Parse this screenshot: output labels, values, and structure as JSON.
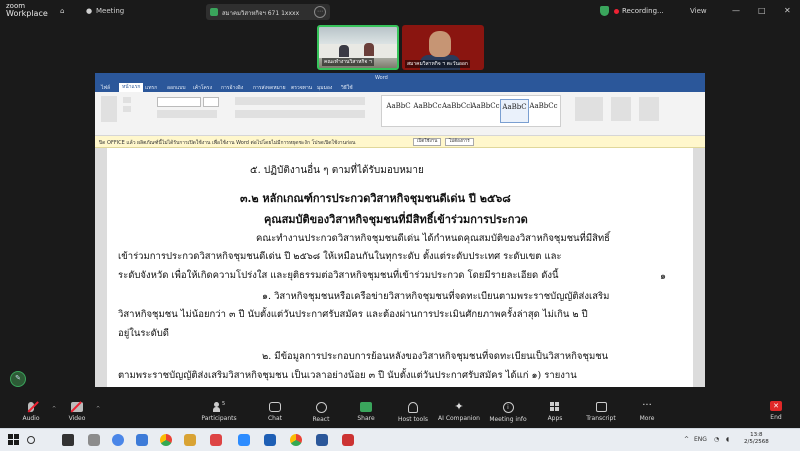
{
  "zoom": {
    "logo": {
      "line1": "zoom",
      "line2": "Workplace"
    },
    "topbar": {
      "home_label": "Home",
      "meeting_label": "Meeting",
      "meeting_pill": "สมาคมวิสาหกิจฯ 671 1xxxx",
      "recording": "Recording...",
      "view": "View",
      "minimize": "—",
      "maximize": "□",
      "close": "✕"
    },
    "participants": [
      {
        "name": "คณะทำงานวิสาหกิจ ฯ"
      },
      {
        "name": "สมาคมวิสาหกิจ ฯ ตะวันออก"
      }
    ],
    "toolbar": {
      "audio": "Audio",
      "video": "Video",
      "participants": "Participants",
      "participants_count": "5",
      "chat": "Chat",
      "react": "React",
      "share": "Share",
      "host_tools": "Host tools",
      "ai_companion": "AI Companion",
      "meeting_info": "Meeting info",
      "apps": "Apps",
      "transcript": "Transcript",
      "more": "More",
      "end": "End"
    }
  },
  "word": {
    "title": "Word",
    "tabs": [
      "ไฟล์",
      "หน้าแรก",
      "แทรก",
      "ออกแบบ",
      "เค้าโครง",
      "การอ้างอิง",
      "การส่งจดหมาย",
      "ตรวจทาน",
      "มุมมอง",
      "วิธีใช้"
    ],
    "active_tab": "หน้าแรก",
    "font_name": "TH SarabunPSK",
    "font_size": "16",
    "styles": [
      "AaBbC",
      "AaBbCc",
      "AaBbCcl",
      "AaBbCc",
      "AaBbC",
      "AaBbCc"
    ],
    "infobar": {
      "message": "ปิด OFFICE แล้ว ผลิตภัณฑ์นี้ไม่ได้รับการเปิดใช้งาน เพื่อใช้งาน Word ต่อไปโดยไม่มีการหยุดชะงัก โปรดเปิดใช้งานก่อน",
      "button1": "เปิดใช้งาน",
      "button2": "ไม่ต้องการ"
    }
  },
  "document": {
    "line_item5": "๕. ปฏิบัติงานอื่น ๆ ตามที่ได้รับมอบหมาย",
    "heading": "๓.๒ หลักเกณฑ์การประกวดวิสาหกิจชุมชนดีเด่น ปี ๒๕๖๘",
    "subheading": "คุณสมบัติของวิสาหกิจชุมชนที่มีสิทธิ์เข้าร่วมการประกวด",
    "lines": [
      "คณะทำงานประกวดวิสาหกิจชุมชนดีเด่น ได้กำหนดคุณสมบัติของวิสาหกิจชุมชนที่มีสิทธิ์",
      "เข้าร่วมการประกวดวิสาหกิจชุมชนดีเด่น ปี ๒๕๖๘ ให้เหมือนกันในทุกระดับ ตั้งแต่ระดับประเทศ ระดับเขต และ",
      "ระดับจังหวัด เพื่อให้เกิดความโปร่งใส และยุติธรรมต่อวิสาหกิจชุมชนที่เข้าร่วมประกวด โดยมีรายละเอียด ดังนี้",
      "๑. วิสาหกิจชุมชนหรือเครือข่ายวิสาหกิจชุมชนที่จดทะเบียนตามพระราชบัญญัติส่งเสริม",
      "วิสาหกิจชุมชน ไม่น้อยกว่า ๓ ปี นับตั้งแต่วันประกาศรับสมัคร และต้องผ่านการประเมินศักยภาพครั้งล่าสุด ไม่เกิน ๒ ปี",
      "อยู่ในระดับดี",
      "๒. มีข้อมูลการประกอบการย้อนหลังของวิสาหกิจชุมชนที่จดทะเบียนเป็นวิสาหกิจชุมชน",
      "ตามพระราชบัญญัติส่งเสริมวิสาหกิจชุมชน เป็นเวลาอย่างน้อย ๓ ปี นับตั้งแต่วันประกาศรับสมัคร ได้แก่ ๑) รายงาน"
    ],
    "trailing_mark": "๑"
  },
  "taskbar": {
    "lang": "ENG",
    "time": "13:8",
    "date": "2/5/2568"
  }
}
